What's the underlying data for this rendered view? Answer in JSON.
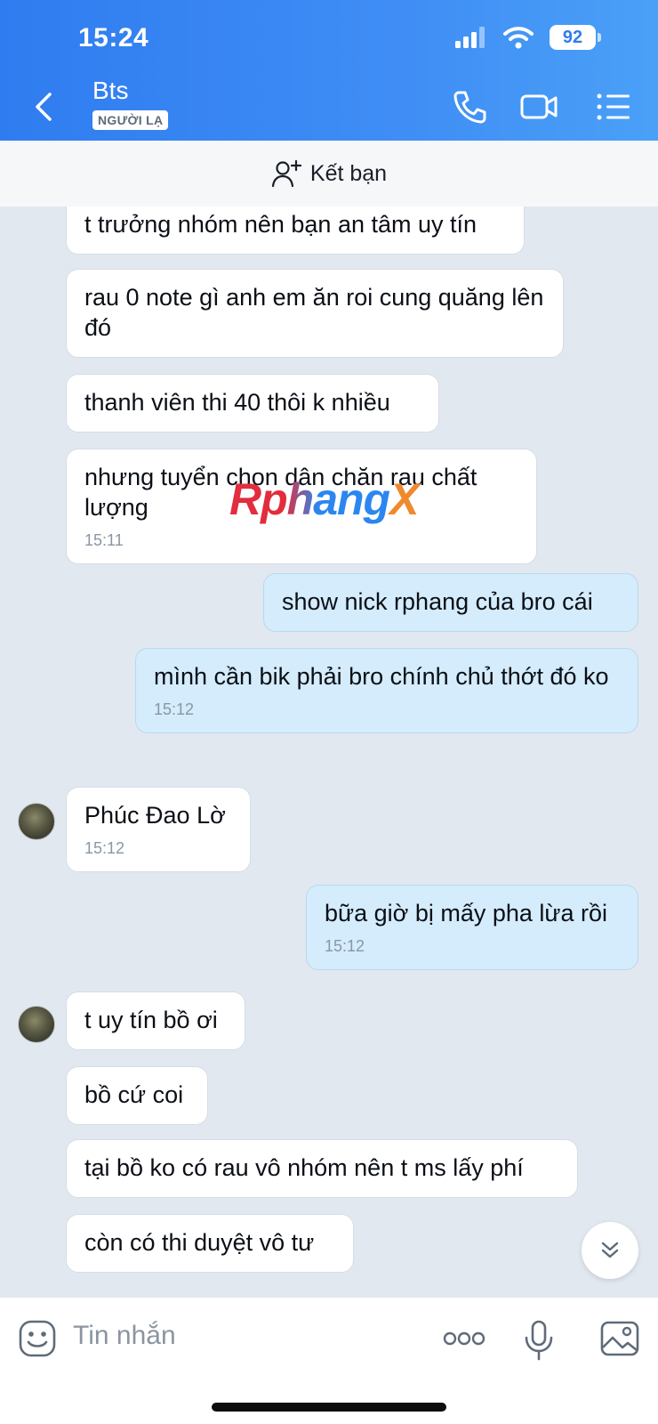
{
  "status_bar": {
    "time": "15:24",
    "battery": "92"
  },
  "header": {
    "title": "Bts",
    "badge": "NGƯỜI LẠ",
    "icons": [
      "back-icon",
      "phone-icon",
      "video-call-icon",
      "menu-list-icon"
    ]
  },
  "friend_bar": {
    "label": "Kết bạn",
    "icon": "add-friend-icon"
  },
  "messages": [
    {
      "dir": "in",
      "text": "t trưởng nhóm nên bạn an tâm uy tín"
    },
    {
      "dir": "in",
      "text": "rau 0 note gì anh em ăn roi cung quăng lên đó"
    },
    {
      "dir": "in",
      "text": "thanh viên thi 40 thôi k nhiều"
    },
    {
      "dir": "in",
      "text": "nhưng tuyển chọn dân chăn rau chất lượng",
      "time": "15:11"
    },
    {
      "dir": "out",
      "text": "show nick rphang của bro cái"
    },
    {
      "dir": "out",
      "text": "mình cần bik phải bro chính chủ thớt đó ko",
      "time": "15:12"
    },
    {
      "dir": "in",
      "text": "Phúc Đao Lờ",
      "time": "15:12",
      "avatar": true
    },
    {
      "dir": "out",
      "text": "bữa giờ bị mấy pha lừa rồi",
      "time": "15:12"
    },
    {
      "dir": "in",
      "text": "t uy tín bồ ơi",
      "avatar": true
    },
    {
      "dir": "in",
      "text": "bồ cứ coi"
    },
    {
      "dir": "in",
      "text": "tại bồ ko có rau vô nhóm nên t ms lấy phí"
    },
    {
      "dir": "in",
      "text": "còn có thi duyệt vô tư"
    }
  ],
  "watermark": {
    "part1": "Rphang",
    "part2": "X"
  },
  "composer": {
    "placeholder": "Tin nhắn",
    "icons": [
      "sticker-icon",
      "more-icon",
      "microphone-icon",
      "image-icon"
    ]
  },
  "colors": {
    "header": "#3a88f3",
    "outgoing_bubble": "#d4ecfb",
    "incoming_bubble": "#ffffff",
    "background": "#e2e8f0"
  }
}
